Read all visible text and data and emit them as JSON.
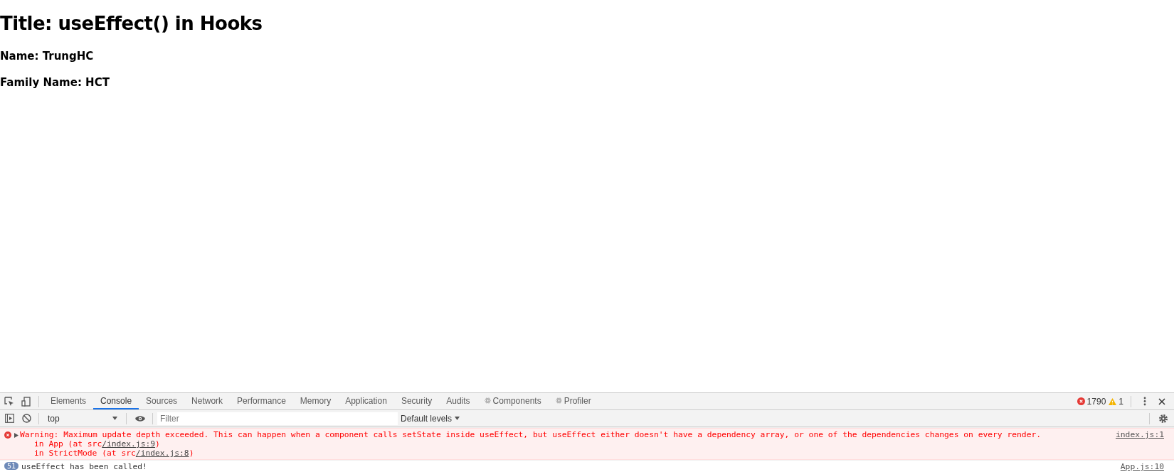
{
  "page": {
    "title": "Title: useEffect() in Hooks",
    "lines": [
      "Name: TrungHC",
      "Family Name: HCT"
    ]
  },
  "devtools": {
    "tabs": [
      {
        "label": "Elements",
        "selected": false,
        "react": false
      },
      {
        "label": "Console",
        "selected": true,
        "react": false
      },
      {
        "label": "Sources",
        "selected": false,
        "react": false
      },
      {
        "label": "Network",
        "selected": false,
        "react": false
      },
      {
        "label": "Performance",
        "selected": false,
        "react": false
      },
      {
        "label": "Memory",
        "selected": false,
        "react": false
      },
      {
        "label": "Application",
        "selected": false,
        "react": false
      },
      {
        "label": "Security",
        "selected": false,
        "react": false
      },
      {
        "label": "Audits",
        "selected": false,
        "react": false
      },
      {
        "label": "Components",
        "selected": false,
        "react": true
      },
      {
        "label": "Profiler",
        "selected": false,
        "react": true
      }
    ],
    "error_count": "1790",
    "warning_count": "1",
    "context": "top",
    "filter": {
      "placeholder": "Filter"
    },
    "levels": "Default levels",
    "messages": [
      {
        "kind": "error",
        "text": "Warning: Maximum update depth exceeded. This can happen when a component calls setState inside useEffect, but useEffect either doesn't have a dependency array, or one of the dependencies changes on every render.",
        "source": "index.js:1",
        "stack": [
          {
            "prefix": "in App (at src",
            "link": "/index.js:9",
            "suffix": ")"
          },
          {
            "prefix": "in StrictMode (at src",
            "link": "/index.js:8",
            "suffix": ")"
          }
        ]
      },
      {
        "kind": "log",
        "count": "51",
        "text": "useEffect has been called!",
        "source": "App.js:10"
      }
    ]
  }
}
